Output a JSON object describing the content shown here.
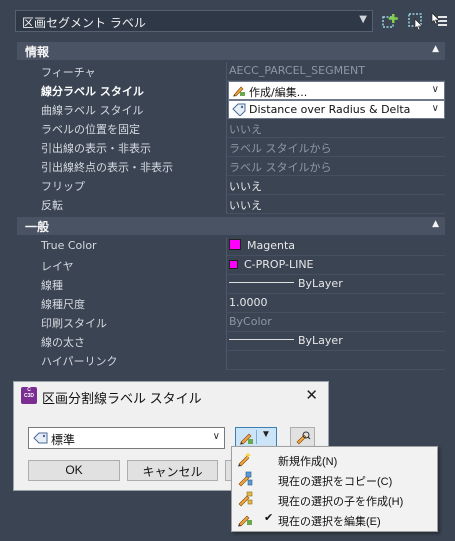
{
  "top": {
    "selector_value": "区画セグメント ラベル"
  },
  "sections": {
    "info": "情報",
    "general": "一般"
  },
  "info_rows": [
    {
      "key": "フィーチャ",
      "value": "AECC_PARCEL_SEGMENT"
    },
    {
      "key": "線分ラベル スタイル",
      "value": "作成/編集..."
    },
    {
      "key": "曲線ラベル スタイル",
      "value": "Distance over Radius & Delta"
    },
    {
      "key": "ラベルの位置を固定",
      "value": "いいえ"
    },
    {
      "key": "引出線の表示・非表示",
      "value": "ラベル スタイルから"
    },
    {
      "key": "引出線終点の表示・非表示",
      "value": "ラベル スタイルから"
    },
    {
      "key": "フリップ",
      "value": "いいえ"
    },
    {
      "key": "反転",
      "value": "いいえ"
    }
  ],
  "general_rows": [
    {
      "key": "True Color",
      "value": "Magenta"
    },
    {
      "key": "レイヤ",
      "value": "C-PROP-LINE"
    },
    {
      "key": "線種",
      "value": "ByLayer"
    },
    {
      "key": "線種尺度",
      "value": "1.0000"
    },
    {
      "key": "印刷スタイル",
      "value": "ByColor"
    },
    {
      "key": "線の太さ",
      "value": "ByLayer"
    },
    {
      "key": "ハイパーリンク",
      "value": ""
    }
  ],
  "colors": {
    "magenta": "#ff00ff",
    "panel_bg": "#3b4453",
    "section_bg": "#4a5364"
  },
  "dialog": {
    "title": "区画分割線ラベル スタイル",
    "app_icon_text": "C",
    "app_icon_sub": "C3D",
    "combo_value": "標準",
    "ok_label": "OK",
    "cancel_label": "キャンセル",
    "close_glyph": "✕"
  },
  "menu": {
    "items": [
      {
        "label": "新規作成(N)",
        "checked": false
      },
      {
        "label": "現在の選択をコピー(C)",
        "checked": false
      },
      {
        "label": "現在の選択の子を作成(H)",
        "checked": false
      },
      {
        "label": "現在の選択を編集(E)",
        "checked": true
      }
    ],
    "check_glyph": "✔"
  }
}
